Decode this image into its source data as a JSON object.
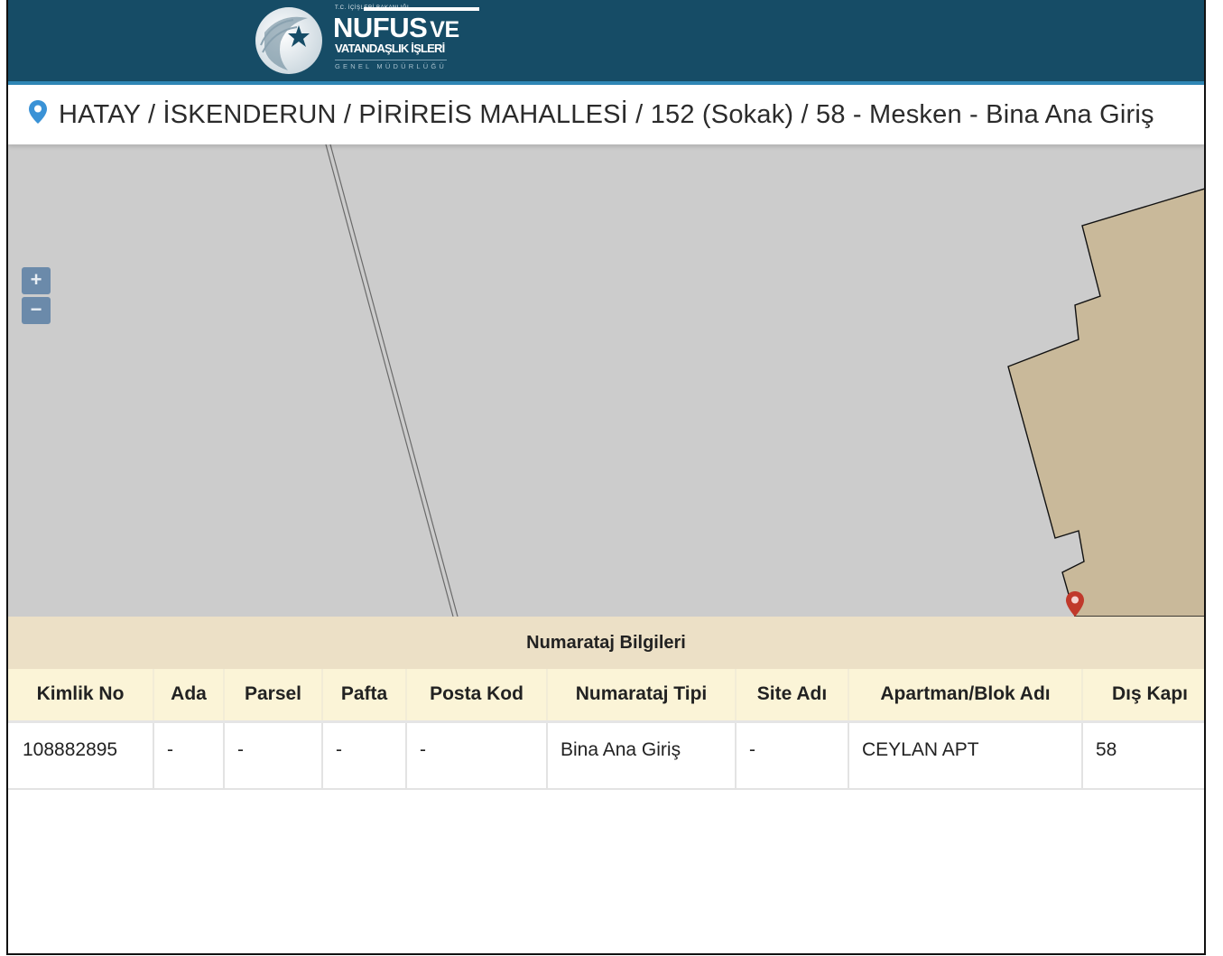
{
  "header": {
    "logo": {
      "ministry_small": "T.C. İÇİŞLERİ BAKANLIĞI",
      "title_main": "NUFUS",
      "title_ve": "VE",
      "title_sub": "VATANDAŞLIK İŞLERİ",
      "tagline": "GENEL MÜDÜRLÜĞÜ"
    },
    "colors": {
      "bar": "#164c66",
      "accent": "#2f86b5"
    }
  },
  "address": {
    "icon": "map-pin-icon",
    "text": "HATAY / İSKENDERUN / PİRİREİS MAHALLESİ / 152 (Sokak) / 58 - Mesken - Bina Ana Giriş"
  },
  "map": {
    "zoom_in_label": "+",
    "zoom_out_label": "−",
    "background": "#cccccc",
    "parcel_fill": "#c9b99a",
    "marker_color": "#c0392b"
  },
  "info_panel": {
    "title": "Numarataj Bilgileri",
    "columns": [
      "Kimlik No",
      "Ada",
      "Parsel",
      "Pafta",
      "Posta Kod",
      "Numarataj Tipi",
      "Site Adı",
      "Apartman/Blok Adı",
      "Dış Kapı"
    ],
    "rows": [
      [
        "108882895",
        "-",
        "-",
        "-",
        "-",
        "Bina Ana Giriş",
        "-",
        "CEYLAN APT",
        "58"
      ]
    ]
  }
}
